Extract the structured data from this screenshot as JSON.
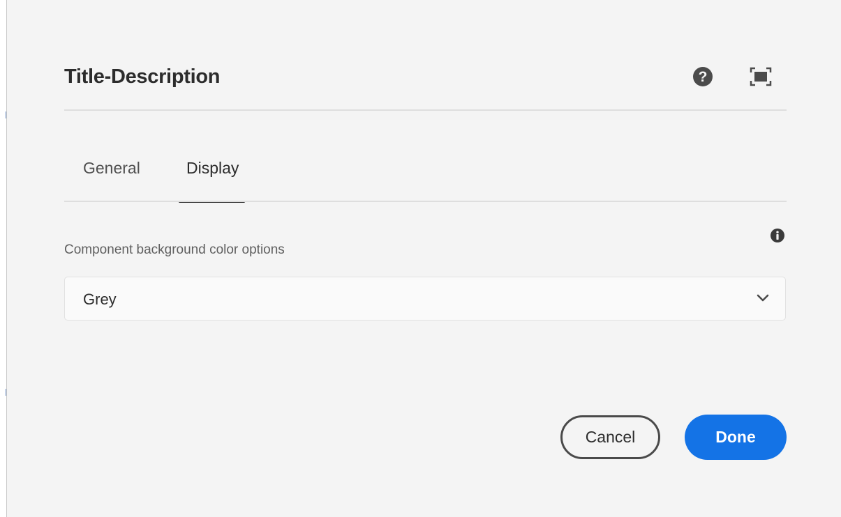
{
  "dialog": {
    "title": "Title-Description",
    "help_icon": "help-circle-icon",
    "fullscreen_icon": "fullscreen-icon"
  },
  "tabs": [
    {
      "label": "General",
      "selected": false
    },
    {
      "label": "Display",
      "selected": true
    }
  ],
  "field": {
    "label": "Component background color options",
    "info_icon": "info-icon",
    "selected_value": "Grey",
    "chevron_icon": "chevron-down-icon"
  },
  "actions": {
    "cancel_label": "Cancel",
    "done_label": "Done"
  },
  "colors": {
    "background": "#f4f4f4",
    "accent": "#1473e6",
    "text": "#2c2c2c",
    "divider": "#dedede"
  }
}
